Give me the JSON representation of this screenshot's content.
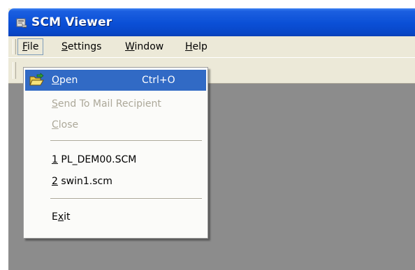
{
  "window": {
    "title": "SCM Viewer",
    "app_icon": "scm-viewer-app-icon"
  },
  "menubar": {
    "items": [
      {
        "accel": "F",
        "rest": "ile"
      },
      {
        "accel": "S",
        "rest": "ettings"
      },
      {
        "accel": "W",
        "rest": "indow"
      },
      {
        "accel": "H",
        "rest": "elp"
      }
    ]
  },
  "file_menu": {
    "open": {
      "accel": "O",
      "rest": "pen",
      "shortcut": "Ctrl+O",
      "icon": "open-folder-icon"
    },
    "send": {
      "accel": "S",
      "rest": "end To Mail Recipient"
    },
    "close": {
      "accel": "C",
      "rest": "lose"
    },
    "recent1": {
      "num": "1",
      "name": " PL_DEM00.SCM"
    },
    "recent2": {
      "num": "2",
      "name": " swin1.scm"
    },
    "exit": {
      "pre": "E",
      "accel": "x",
      "rest": "it"
    }
  },
  "colors": {
    "titlebar": "#0a4fd6",
    "menu_highlight": "#316ac5",
    "client_area": "#8c8c8c",
    "disabled_text": "#aca899"
  }
}
